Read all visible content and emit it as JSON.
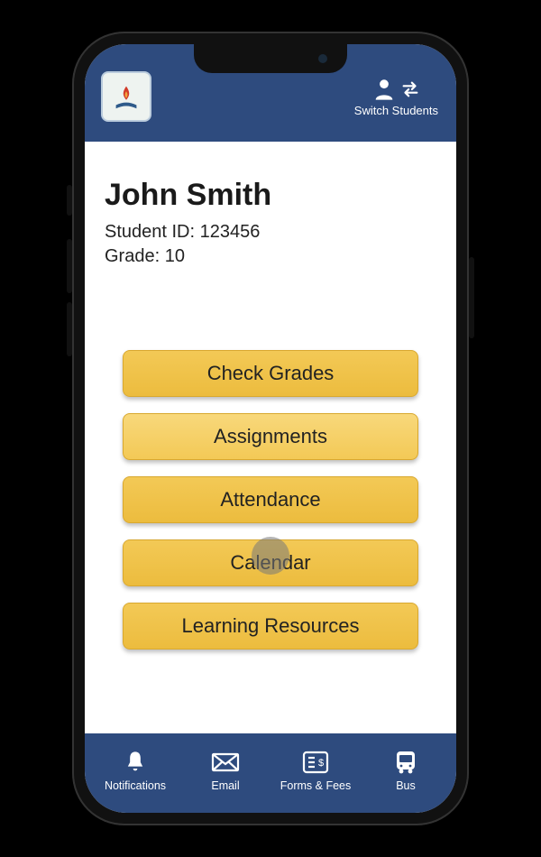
{
  "header": {
    "switch_label": "Switch Students"
  },
  "student": {
    "name": "John Smith",
    "id_label": "Student ID: 123456",
    "grade_label": "Grade: 10"
  },
  "actions": {
    "grades": "Check Grades",
    "assignments": "Assignments",
    "attendance": "Attendance",
    "calendar": "Calendar",
    "resources": "Learning Resources"
  },
  "nav": {
    "notifications": "Notifications",
    "email": "Email",
    "forms": "Forms & Fees",
    "bus": "Bus"
  }
}
